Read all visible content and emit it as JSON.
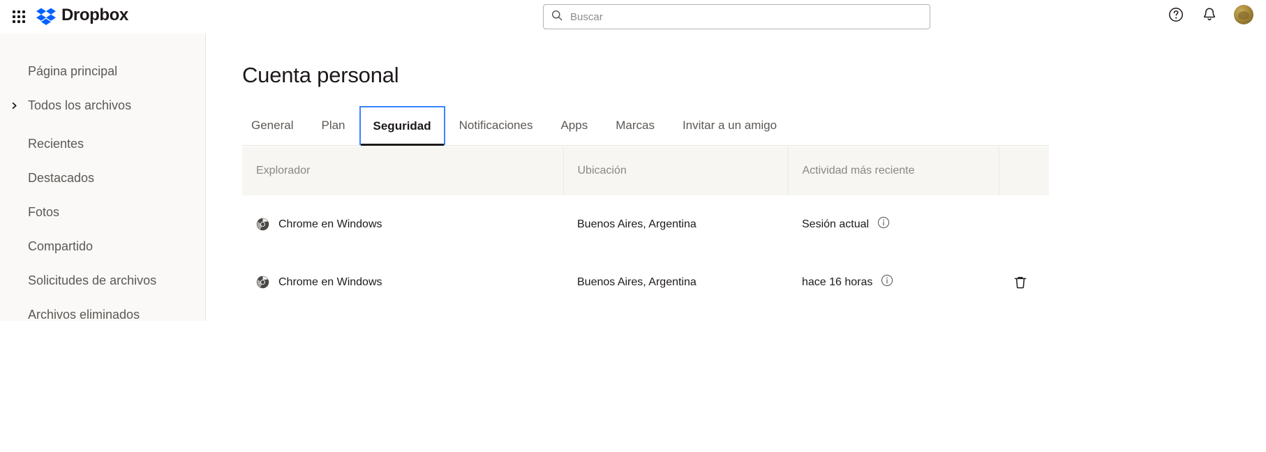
{
  "topbar": {
    "grid_menu_icon": "grid-apps-icon",
    "brand_name": "Dropbox",
    "brand_logo_icon": "dropbox-logo-icon",
    "brand_color": "#0061ff",
    "search": {
      "icon": "search-icon",
      "placeholder": "Buscar",
      "value": ""
    },
    "help_icon": "help-circle-icon",
    "notifications_icon": "bell-icon",
    "avatar_icon": "user-avatar"
  },
  "sidebar": {
    "background_color": "#faf9f7",
    "items": [
      {
        "label": "Página principal",
        "has_chevron": false
      },
      {
        "label": "Todos los archivos",
        "has_chevron": true,
        "chevron_icon": "chevron-right-icon"
      },
      {
        "label": "Recientes",
        "has_chevron": false
      },
      {
        "label": "Destacados",
        "has_chevron": false
      },
      {
        "label": "Fotos",
        "has_chevron": false
      },
      {
        "label": "Compartido",
        "has_chevron": false
      },
      {
        "label": "Solicitudes de archivos",
        "has_chevron": false
      },
      {
        "label": "Archivos eliminados",
        "has_chevron": false
      }
    ]
  },
  "main": {
    "page_title": "Cuenta personal",
    "accent_focus_color": "#3984ff",
    "tabs": [
      {
        "label": "General",
        "active": false
      },
      {
        "label": "Plan",
        "active": false
      },
      {
        "label": "Seguridad",
        "active": true
      },
      {
        "label": "Notificaciones",
        "active": false
      },
      {
        "label": "Apps",
        "active": false
      },
      {
        "label": "Marcas",
        "active": false
      },
      {
        "label": "Invitar a un amigo",
        "active": false
      }
    ],
    "sessions_table": {
      "columns": [
        "Explorador",
        "Ubicación",
        "Actividad más reciente",
        ""
      ],
      "rows": [
        {
          "browser_icon": "chrome-icon",
          "browser": "Chrome en Windows",
          "location": "Buenos Aires, Argentina",
          "activity": "Sesión actual",
          "info_icon": "info-circle-icon",
          "has_delete": false,
          "delete_icon": ""
        },
        {
          "browser_icon": "chrome-icon",
          "browser": "Chrome en Windows",
          "location": "Buenos Aires, Argentina",
          "activity": "hace 16 horas",
          "info_icon": "info-circle-icon",
          "has_delete": true,
          "delete_icon": "trash-icon"
        }
      ]
    }
  }
}
